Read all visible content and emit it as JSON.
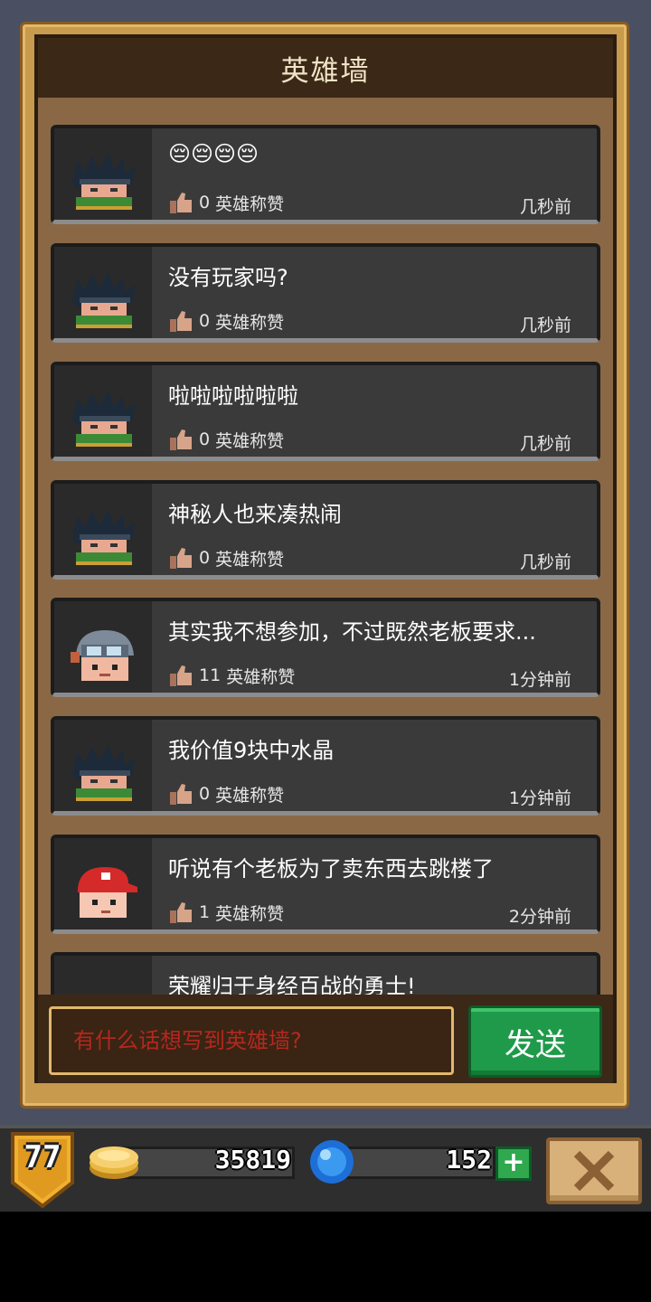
{
  "title": "英雄墙",
  "messages": [
    {
      "text": "😔😔😔😔",
      "likes": "0",
      "like_label": "英雄称赞",
      "time": "几秒前",
      "avatar": "spiky-hair-avatar"
    },
    {
      "text": "没有玩家吗?",
      "likes": "0",
      "like_label": "英雄称赞",
      "time": "几秒前",
      "avatar": "spiky-hair-avatar"
    },
    {
      "text": "啦啦啦啦啦啦",
      "likes": "0",
      "like_label": "英雄称赞",
      "time": "几秒前",
      "avatar": "spiky-hair-avatar"
    },
    {
      "text": "神秘人也来凑热闹",
      "likes": "0",
      "like_label": "英雄称赞",
      "time": "几秒前",
      "avatar": "spiky-hair-avatar"
    },
    {
      "text": "其实我不想参加，不过既然老板要求...",
      "likes": "11",
      "like_label": "英雄称赞",
      "time": "1分钟前",
      "avatar": "goggles-avatar"
    },
    {
      "text": "我价值9块中水晶",
      "likes": "0",
      "like_label": "英雄称赞",
      "time": "1分钟前",
      "avatar": "spiky-hair-avatar"
    },
    {
      "text": "听说有个老板为了卖东西去跳楼了",
      "likes": "1",
      "like_label": "英雄称赞",
      "time": "2分钟前",
      "avatar": "red-cap-avatar"
    },
    {
      "text": "荣耀归于身经百战的勇士!",
      "likes": "",
      "like_label": "",
      "time": "",
      "avatar": "gray-avatar"
    }
  ],
  "input": {
    "placeholder": "有什么话想写到英雄墙?"
  },
  "send_label": "发送",
  "hud": {
    "level": "77",
    "gold": "35819",
    "gems": "152",
    "plus": "+"
  },
  "colors": {
    "send_green": "#1f9a4a",
    "frame_gold": "#c79a4e",
    "placeholder_red": "#b3281e"
  }
}
